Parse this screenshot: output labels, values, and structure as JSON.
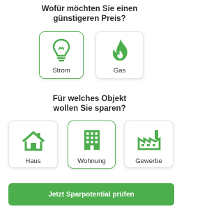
{
  "energy": {
    "question": "Wofür möchten Sie einen\ngünstigeren Preis?",
    "options": [
      {
        "label": "Strom",
        "icon": "lightbulb-icon",
        "selected": true
      },
      {
        "label": "Gas",
        "icon": "flame-icon",
        "selected": false
      }
    ]
  },
  "object": {
    "question": "Für welches Objekt\nwollen Sie sparen?",
    "options": [
      {
        "label": "Haus",
        "icon": "house-icon",
        "selected": false
      },
      {
        "label": "Wohnung",
        "icon": "building-icon",
        "selected": true
      },
      {
        "label": "Gewerbe",
        "icon": "factory-icon",
        "selected": false
      }
    ]
  },
  "cta": {
    "label": "Jetzt Sparpotential prüfen"
  },
  "colors": {
    "accent": "#4cae4c",
    "selected_border": "#5fb35a",
    "text": "#2b2b2b"
  }
}
